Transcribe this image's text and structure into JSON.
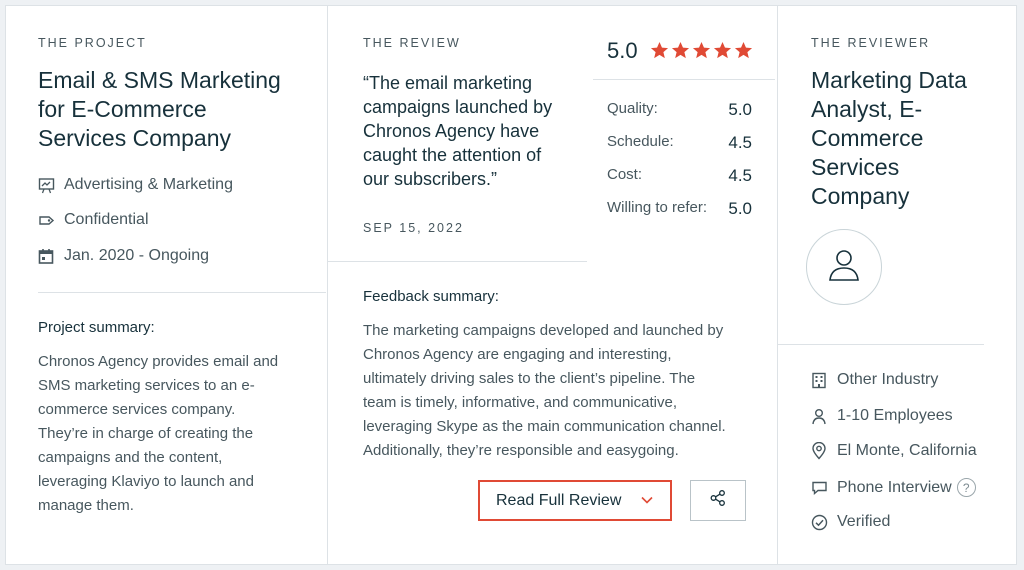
{
  "project": {
    "section_label": "THE PROJECT",
    "title_lines": [
      "Email & SMS Marketing",
      "for E-Commerce",
      "Services Company"
    ],
    "meta": [
      {
        "icon": "presentation-chart-icon",
        "text": "Advertising & Marketing"
      },
      {
        "icon": "price-tag-icon",
        "text": "Confidential"
      },
      {
        "icon": "calendar-icon",
        "text": "Jan. 2020 - Ongoing"
      }
    ],
    "summary_heading": "Project summary:",
    "summary_lines": [
      "Chronos Agency provides email and",
      "SMS marketing services to an e-",
      "commerce services company.",
      "They’re in charge of creating the",
      "campaigns and the content,",
      "leveraging Klaviyo to launch and",
      "manage them."
    ]
  },
  "review": {
    "section_label": "THE REVIEW",
    "quote_lines": [
      "“The email marketing",
      "campaigns launched by",
      "Chronos Agency have",
      "caught the attention of",
      "our subscribers.”"
    ],
    "date": "SEP 15, 2022",
    "overall_score": "5.0",
    "star_rating": 5,
    "star_color": "#e04a35",
    "ratings": [
      {
        "label": "Quality:",
        "value": "5.0"
      },
      {
        "label": "Schedule:",
        "value": "4.5"
      },
      {
        "label": "Cost:",
        "value": "4.5"
      },
      {
        "label": "Willing to refer:",
        "value": "5.0"
      }
    ],
    "feedback_heading": "Feedback summary:",
    "feedback_lines": [
      "The marketing campaigns developed and launched by",
      "Chronos Agency are engaging and interesting,",
      "ultimately driving sales to the client’s pipeline. The",
      "team is timely, informative, and communicative,",
      "leveraging Skype as the main communication channel.",
      "Additionally, they’re responsible and easygoing."
    ],
    "read_full_review_label": "Read Full Review",
    "accent_color": "#e04a35"
  },
  "reviewer": {
    "section_label": "THE REVIEWER",
    "title_lines": [
      "Marketing Data",
      "Analyst, E-",
      "Commerce",
      "Services",
      "Company"
    ],
    "meta": [
      {
        "icon": "building-icon",
        "text": "Other Industry"
      },
      {
        "icon": "user-icon",
        "text": "1-10 Employees"
      },
      {
        "icon": "location-pin-icon",
        "text": "El Monte, California"
      },
      {
        "icon": "chat-bubble-icon",
        "text": "Phone Interview"
      },
      {
        "icon": "check-circle-icon",
        "text": "Verified"
      }
    ],
    "help_glyph": "?"
  }
}
